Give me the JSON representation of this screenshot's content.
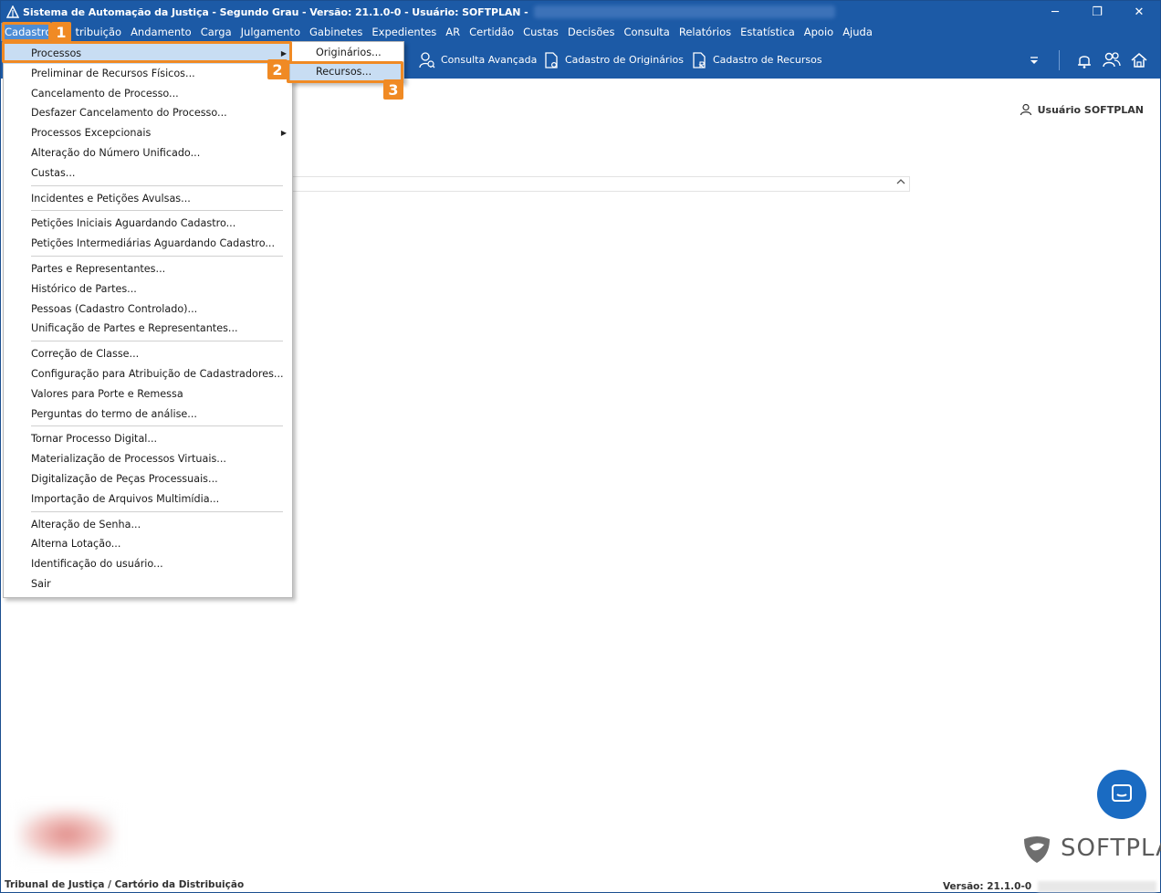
{
  "window": {
    "title": "Sistema de Automação da Justiça - Segundo Grau - Versão: 21.1.0-0 - Usuário: SOFTPLAN -",
    "controls": {
      "minimize": "─",
      "maximize": "❐",
      "close": "✕"
    }
  },
  "menubar": {
    "items": [
      "Cadastro",
      "tribuição",
      "Andamento",
      "Carga",
      "Julgamento",
      "Gabinetes",
      "Expedientes",
      "AR",
      "Certidão",
      "Custas",
      "Decisões",
      "Consulta",
      "Relatórios",
      "Estatística",
      "Apoio",
      "Ajuda"
    ],
    "active_index": 0
  },
  "toolbar": {
    "consulta_avancada": "Consulta Avançada",
    "cadastro_originarios": "Cadastro de Originários",
    "cadastro_recursos": "Cadastro de Recursos"
  },
  "user": {
    "label": "Usuário SOFTPLAN"
  },
  "dropdown": {
    "items": [
      {
        "label": "Processos",
        "submenu": true,
        "highlight": true
      },
      {
        "label": "Preliminar de Recursos Físicos..."
      },
      {
        "label": "Cancelamento de Processo..."
      },
      {
        "label": "Desfazer Cancelamento do Processo..."
      },
      {
        "label": "Processos Excepcionais",
        "submenu": true
      },
      {
        "label": "Alteração do Número Unificado..."
      },
      {
        "label": "Custas..."
      },
      {
        "separator": true
      },
      {
        "label": "Incidentes e Petições Avulsas..."
      },
      {
        "separator": true
      },
      {
        "label": "Petições Iniciais Aguardando Cadastro..."
      },
      {
        "label": "Petições Intermediárias Aguardando Cadastro..."
      },
      {
        "separator": true
      },
      {
        "label": "Partes e Representantes..."
      },
      {
        "label": "Histórico de Partes..."
      },
      {
        "label": "Pessoas (Cadastro Controlado)..."
      },
      {
        "label": "Unificação de Partes e Representantes..."
      },
      {
        "separator": true
      },
      {
        "label": "Correção de Classe..."
      },
      {
        "label": "Configuração para Atribuição de Cadastradores..."
      },
      {
        "label": "Valores para Porte e Remessa"
      },
      {
        "label": "Perguntas do termo de análise..."
      },
      {
        "separator": true
      },
      {
        "label": "Tornar Processo Digital..."
      },
      {
        "label": "Materialização de Processos Virtuais..."
      },
      {
        "label": "Digitalização de Peças Processuais..."
      },
      {
        "label": "Importação de Arquivos Multimídia..."
      },
      {
        "separator": true
      },
      {
        "label": "Alteração de Senha..."
      },
      {
        "label": "Alterna Lotação..."
      },
      {
        "label": "Identificação do usuário..."
      },
      {
        "label": "Sair"
      }
    ]
  },
  "submenu": {
    "items": [
      {
        "label": "Originários..."
      },
      {
        "label": "Recursos...",
        "highlight": true
      }
    ]
  },
  "steps": [
    "1",
    "2",
    "3"
  ],
  "brand": {
    "name": "SOFTPLAN"
  },
  "status": {
    "left": "Tribunal de Justiça / Cartório da Distribuição",
    "version": "Versão: 21.1.0-0"
  },
  "colors": {
    "header_blue": "#1c5aa6",
    "highlight_orange": "#f08a24",
    "menu_highlight": "#c8ddf3"
  }
}
